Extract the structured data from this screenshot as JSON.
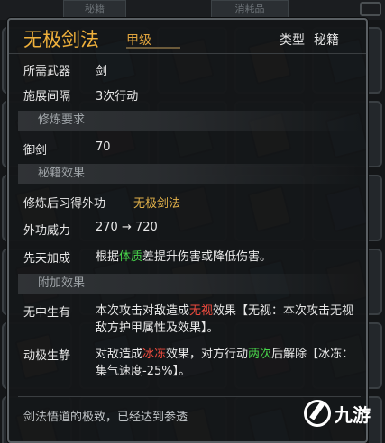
{
  "background": {
    "tabs": [
      "秘籍",
      "消耗品"
    ],
    "slot_colors": [
      "#6b4a2a",
      "#2f5d7a",
      "#5a3d26",
      "#7a5a2f",
      "#2e4f68",
      "#4a5560",
      "#6a2e2e",
      "#3a5a44",
      "#5e4a2c",
      "#2c4a66",
      "#6a4e34",
      "#35505c",
      "#4e3a28",
      "#6a5430",
      "#2b4660",
      "#5a2f30",
      "#3e4b56",
      "#6b4a2a",
      "#2f5d7a",
      "#5a3d26",
      "#7a5a2f",
      "#2e4f68",
      "#4a5560",
      "#6a2e2e",
      "#3a5a44",
      "#5e4a2c",
      "#2c4a66",
      "#6a4e34",
      "#35505c",
      "#4e3a28"
    ]
  },
  "tooltip": {
    "name": "无极剑法",
    "grade": "甲级",
    "type_label": "类型",
    "type_value": "秘籍",
    "fields": [
      {
        "label": "所需武器",
        "value": "剑"
      },
      {
        "label": "施展间隔",
        "value": "3次行动"
      }
    ],
    "sections": {
      "requirements": "修炼要求",
      "effects": "秘籍效果",
      "extra": "附加效果"
    },
    "requirement": {
      "label": "御剑",
      "value": "70"
    },
    "effect_rows": [
      {
        "label": "修炼后习得外功",
        "value": "无极剑法"
      },
      {
        "label": "外功威力",
        "value": "270 → 720"
      }
    ],
    "innate": {
      "label": "先天加成",
      "pre": "根据",
      "highlight": "体质",
      "post": "差提升伤害或降低伤害。"
    },
    "extra_rows": [
      {
        "label": "无中生有",
        "pre": "本次攻击对敌造成",
        "highlight": "无视",
        "post": "效果【无视：本次攻击无视敌方护甲属性及效果】。"
      },
      {
        "label": "动极生静",
        "pre": "对敌造成",
        "highlight1": "冰冻",
        "mid": "效果，对方行动",
        "highlight2": "两次",
        "post": "后解除【冰冻：集气速度-25%】。"
      }
    ],
    "footer": "剑法悟道的极致，已经达到参透"
  },
  "watermark": "九游",
  "colors": {
    "gold": "#f0b13c",
    "green": "#47d34a",
    "red": "#ef4b3e"
  }
}
